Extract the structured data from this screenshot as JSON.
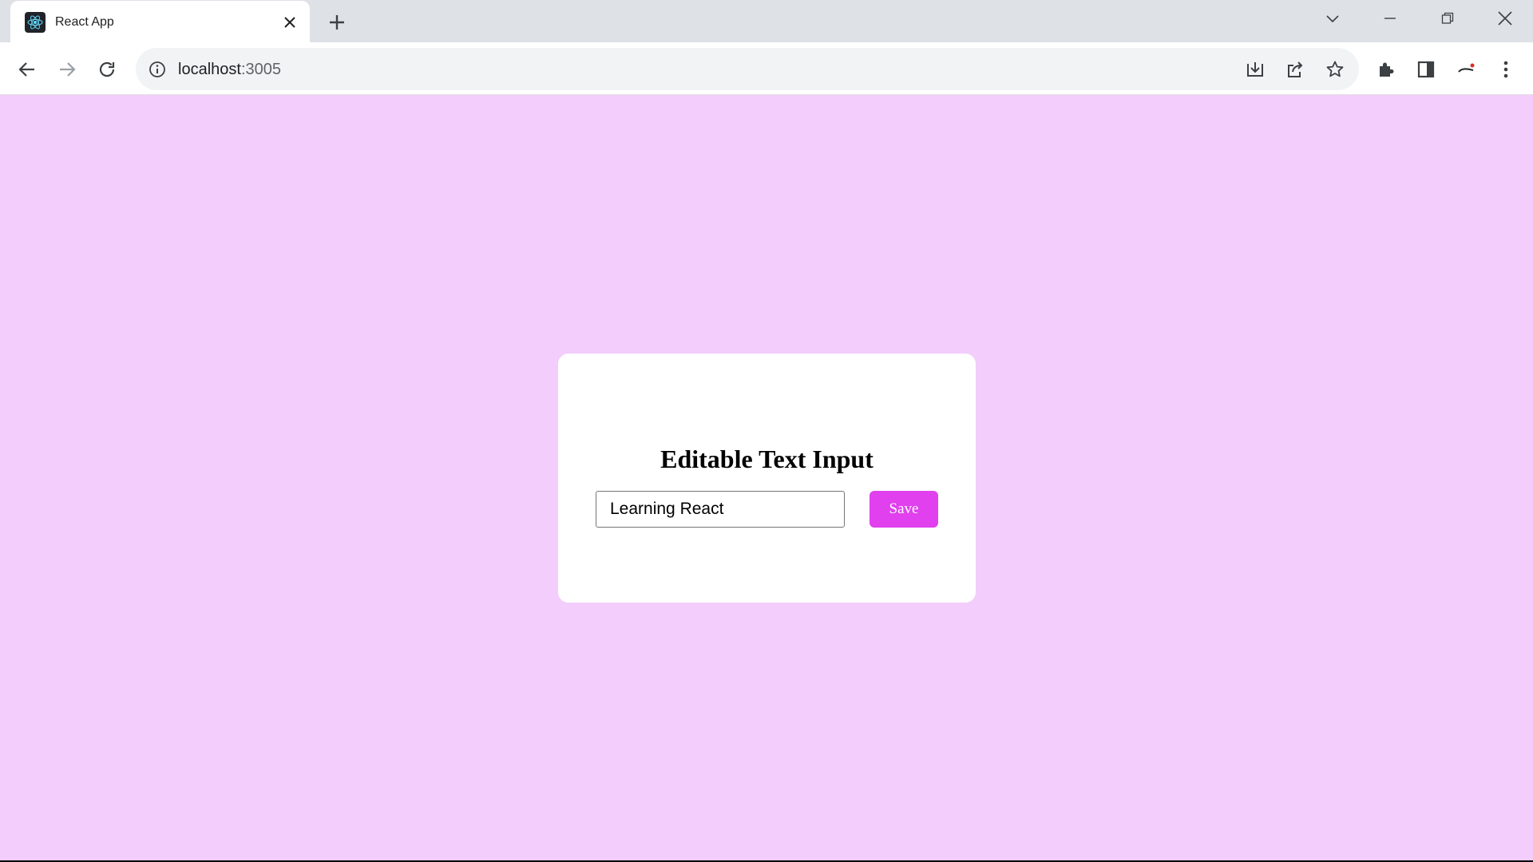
{
  "browser": {
    "tab": {
      "title": "React App",
      "favicon": "react-logo-icon"
    },
    "address": {
      "host": "localhost",
      "port": ":3005"
    }
  },
  "page": {
    "title": "Editable Text Input",
    "input_value": "Learning React",
    "save_label": "Save",
    "colors": {
      "background": "#f3cdfb",
      "card": "#ffffff",
      "button": "#e040ee"
    }
  }
}
